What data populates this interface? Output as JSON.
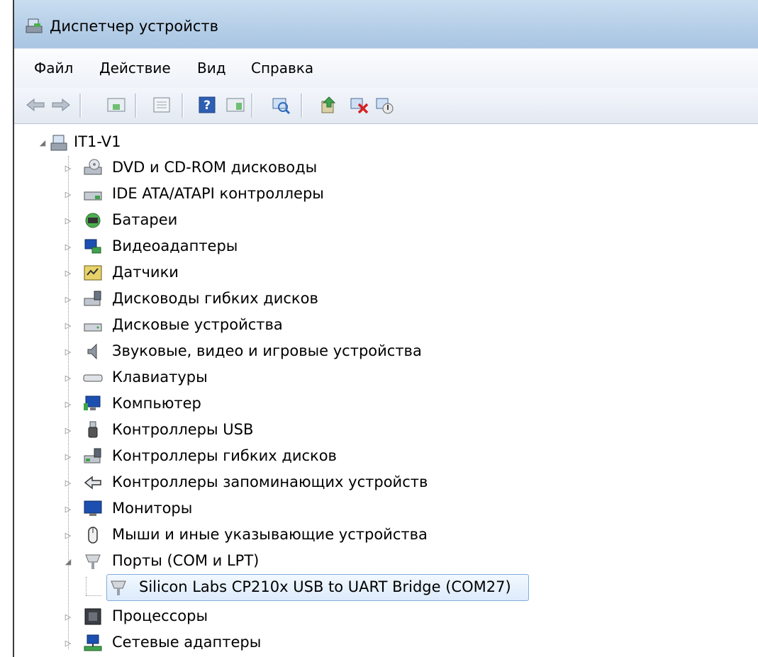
{
  "window": {
    "title": "Диспетчер устройств"
  },
  "menu": {
    "items": [
      "Файл",
      "Действие",
      "Вид",
      "Справка"
    ]
  },
  "toolbar": {
    "icons": [
      "back-arrow-icon",
      "forward-arrow-icon",
      "show-hide-tree-icon",
      "properties-icon",
      "help-icon",
      "action-pane-icon",
      "scan-hardware-icon",
      "update-driver-icon",
      "uninstall-device-icon",
      "disable-device-icon"
    ]
  },
  "tree": {
    "root": "IT1-V1",
    "categories": [
      "DVD и CD-ROM дисководы",
      "IDE ATA/ATAPI контроллеры",
      "Батареи",
      "Видеоадаптеры",
      "Датчики",
      "Дисководы гибких дисков",
      "Дисковые устройства",
      "Звуковые, видео и игровые устройства",
      "Клавиатуры",
      "Компьютер",
      "Контроллеры USB",
      "Контроллеры гибких дисков",
      "Контроллеры запоминающих устройств",
      "Мониторы",
      "Мыши и иные указывающие устройства",
      "Порты (COM и LPT)",
      "Silicon Labs CP210x USB to UART Bridge (COM27)",
      "Процессоры",
      "Сетевые адаптеры"
    ]
  },
  "colors": {
    "titlebar": "#b6cfe8",
    "selection_border": "#84acdd",
    "selection_fill": "#dcebfc"
  }
}
